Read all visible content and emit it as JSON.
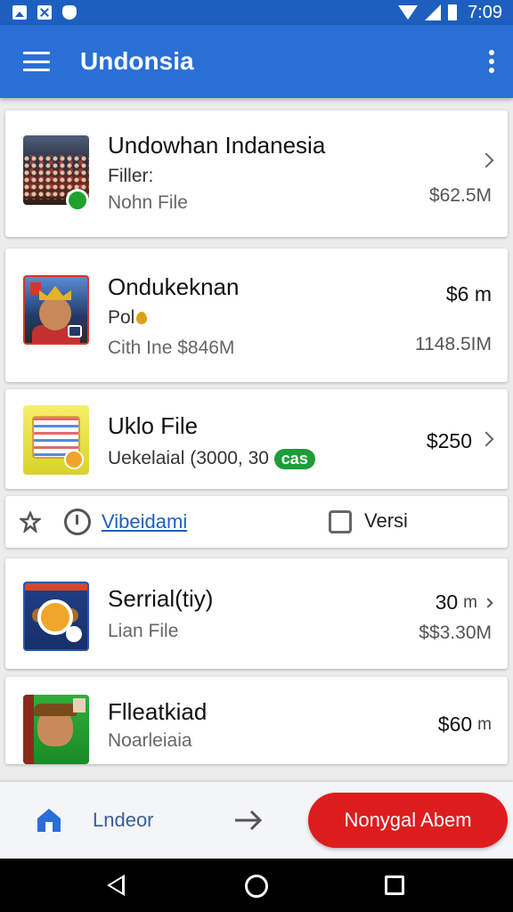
{
  "status_bar": {
    "time": "7:09",
    "icons": [
      "image-icon",
      "close-box-icon",
      "shield-icon",
      "wifi-icon",
      "signal-icon",
      "battery-icon"
    ]
  },
  "app_bar": {
    "title": "Undonsia",
    "menu_icon": "hamburger-menu-icon",
    "more_icon": "more-vertical-icon"
  },
  "items": [
    {
      "title": "Undowhan Indanesia",
      "line1": "Filler:",
      "line2": "Nohn File",
      "price": "$62.5M",
      "trailing": "chevron-right-icon"
    },
    {
      "title": "Ondukeknan",
      "line1": "Pol",
      "line2": "Cith Ine $846M",
      "price_top": "$6 m",
      "price": "1148.5IM"
    },
    {
      "title": "Uklo File",
      "line1": "Uekelaial (3000, 30",
      "pill": "cas",
      "price": "$250",
      "trailing": "chevron-right-icon"
    },
    {
      "title": "Serrial(tiy)",
      "line1": "Lian File",
      "price_top": "30",
      "price_unit": "m",
      "price": "$$3.30M"
    },
    {
      "title": "Flleatkiad",
      "line1": "Noarleiaia",
      "price_top": "$60",
      "price_unit": "m"
    }
  ],
  "action_row": {
    "link": "Vibeidami",
    "versi": "Versi"
  },
  "bottom_bar": {
    "home_label": "Lndeor",
    "button_label": "Nonygal Abem"
  },
  "colors": {
    "status_bar": "#1d5fbf",
    "app_bar": "#2a6fd6",
    "button_red": "#dd1d1d",
    "link_blue": "#1f5fbf",
    "badge_green": "#1e9c3a"
  }
}
